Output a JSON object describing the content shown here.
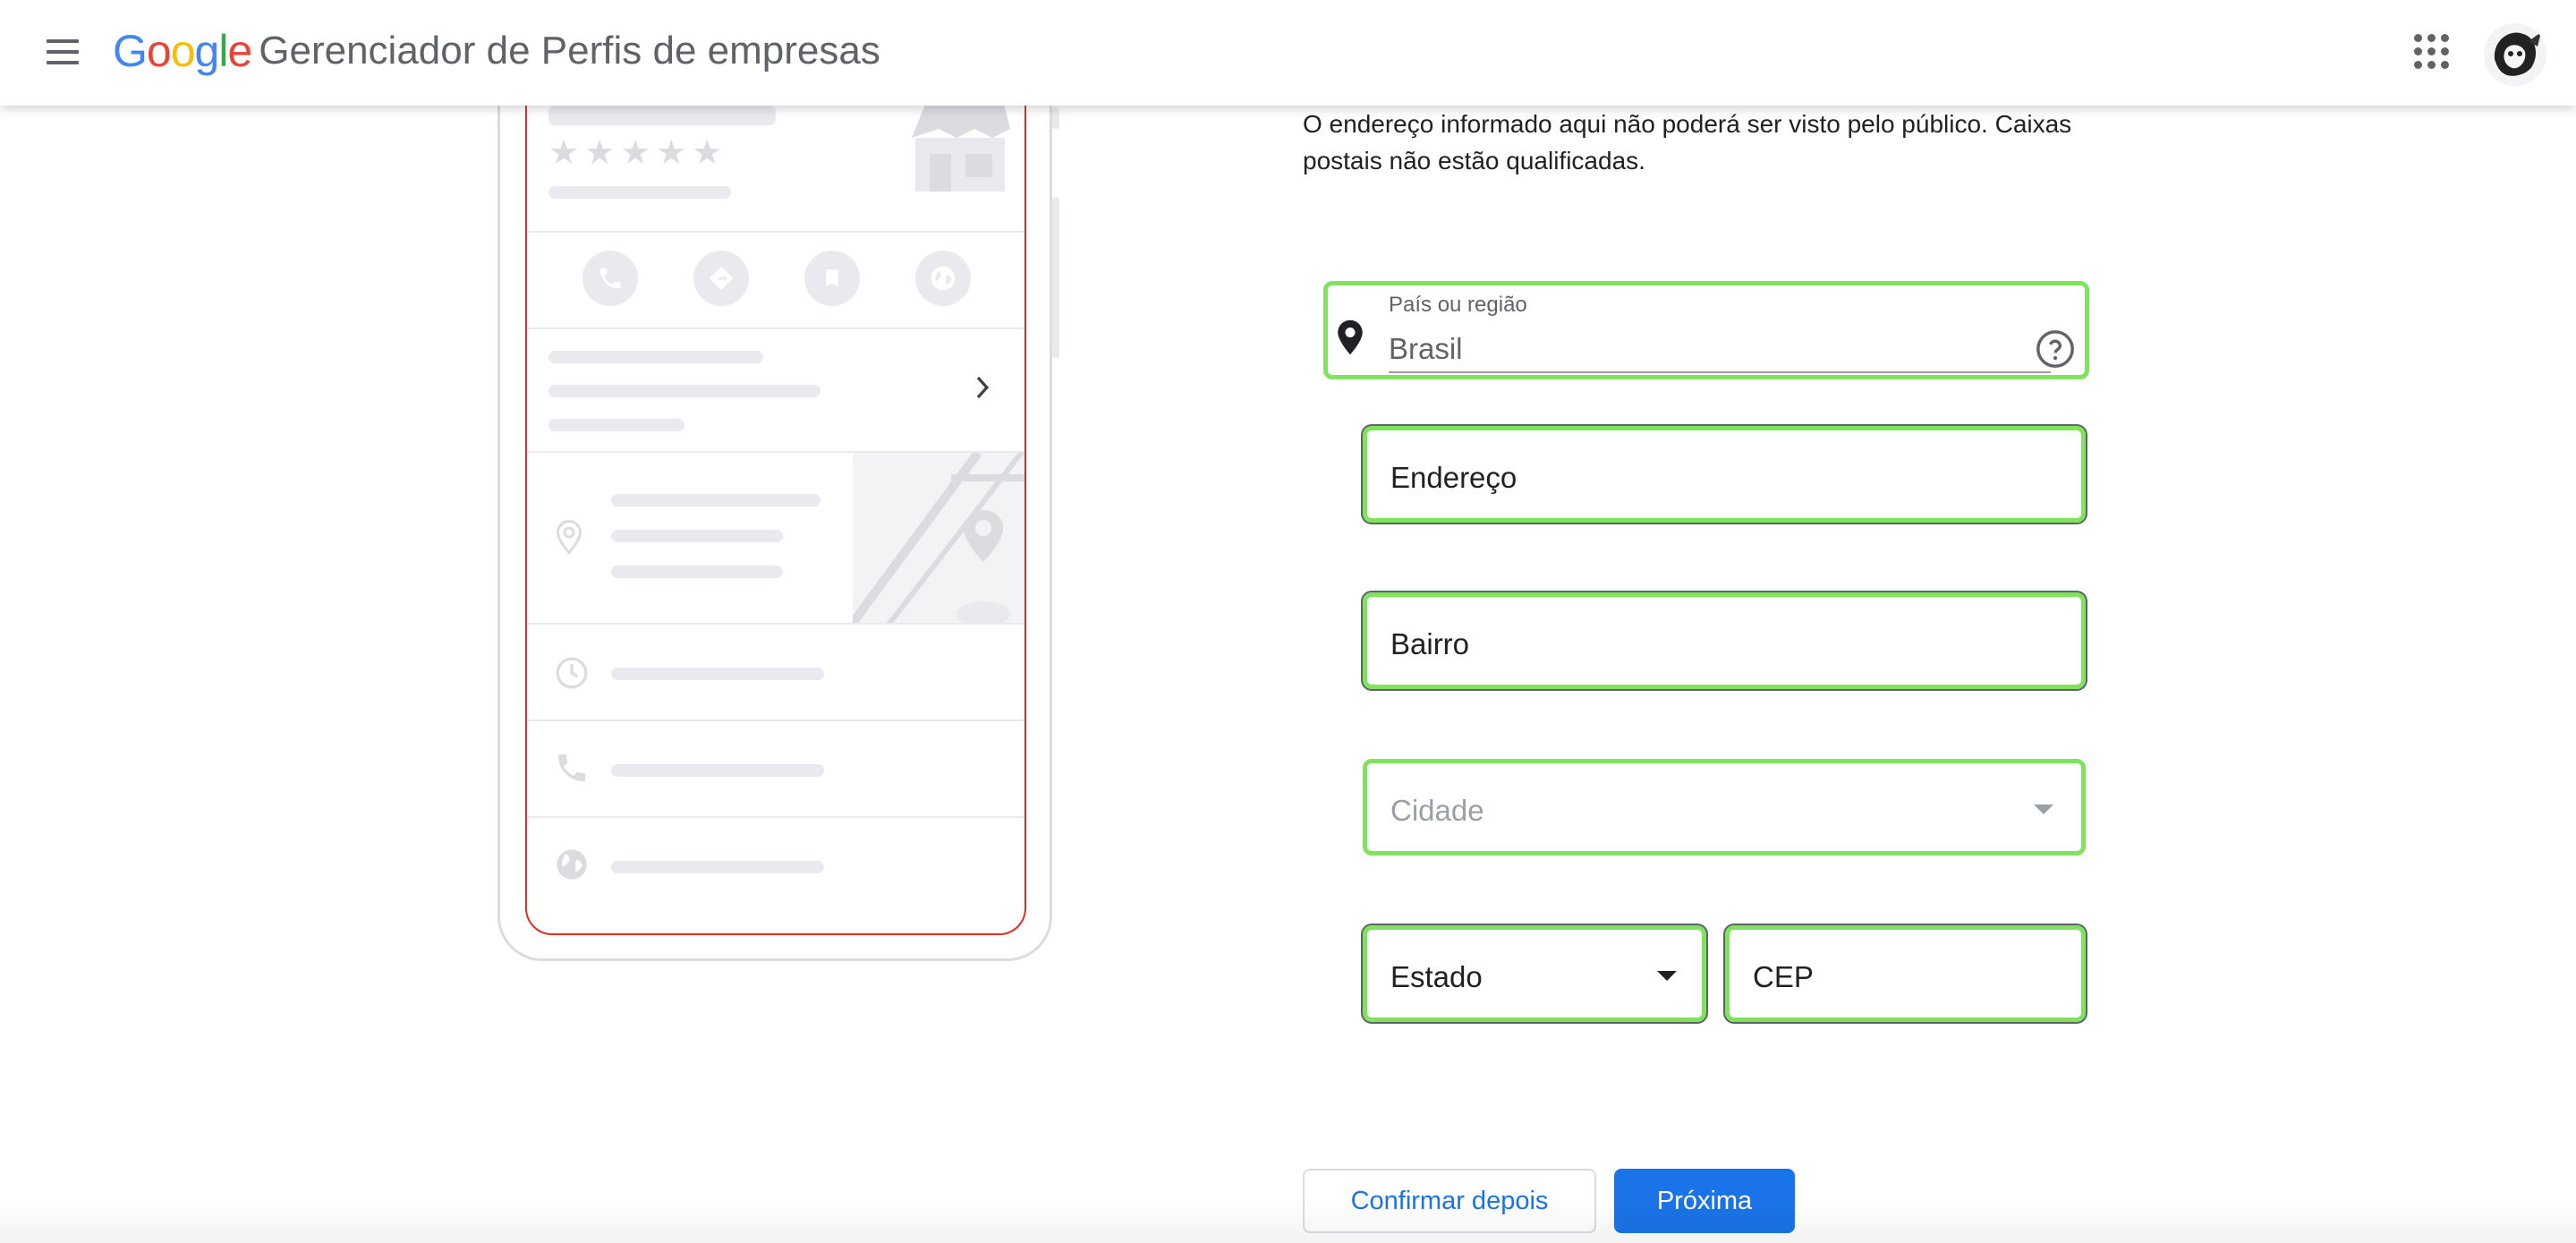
{
  "header": {
    "menu_icon": "hamburger-menu-icon",
    "logo_letters": [
      {
        "char": "G",
        "color": "#4285F4"
      },
      {
        "char": "o",
        "color": "#EA4335"
      },
      {
        "char": "o",
        "color": "#FBBC05"
      },
      {
        "char": "g",
        "color": "#4285F4"
      },
      {
        "char": "l",
        "color": "#34A853"
      },
      {
        "char": "e",
        "color": "#EA4335"
      }
    ],
    "product_name": "Gerenciador de Perfis de empresas",
    "apps_icon": "apps-grid-icon",
    "avatar_icon": "user-avatar"
  },
  "form": {
    "description": "O endereço informado aqui não poderá ser visto pelo público. Caixas postais não estão qualificadas.",
    "country": {
      "label": "País ou região",
      "value": "Brasil",
      "icon": "location-pin-icon",
      "help_icon": "help-circle-icon"
    },
    "address": {
      "placeholder": "Endereço"
    },
    "neighborhood": {
      "placeholder": "Bairro"
    },
    "city": {
      "placeholder": "Cidade"
    },
    "state": {
      "value": "Estado"
    },
    "zip": {
      "placeholder": "CEP"
    }
  },
  "actions": {
    "later_label": "Confirmar depois",
    "next_label": "Próxima"
  },
  "colors": {
    "accent": "#1a73e8",
    "highlight": "#7fe35e",
    "phone_border": "#d93025",
    "placeholder_gray": "#e8eaed"
  }
}
